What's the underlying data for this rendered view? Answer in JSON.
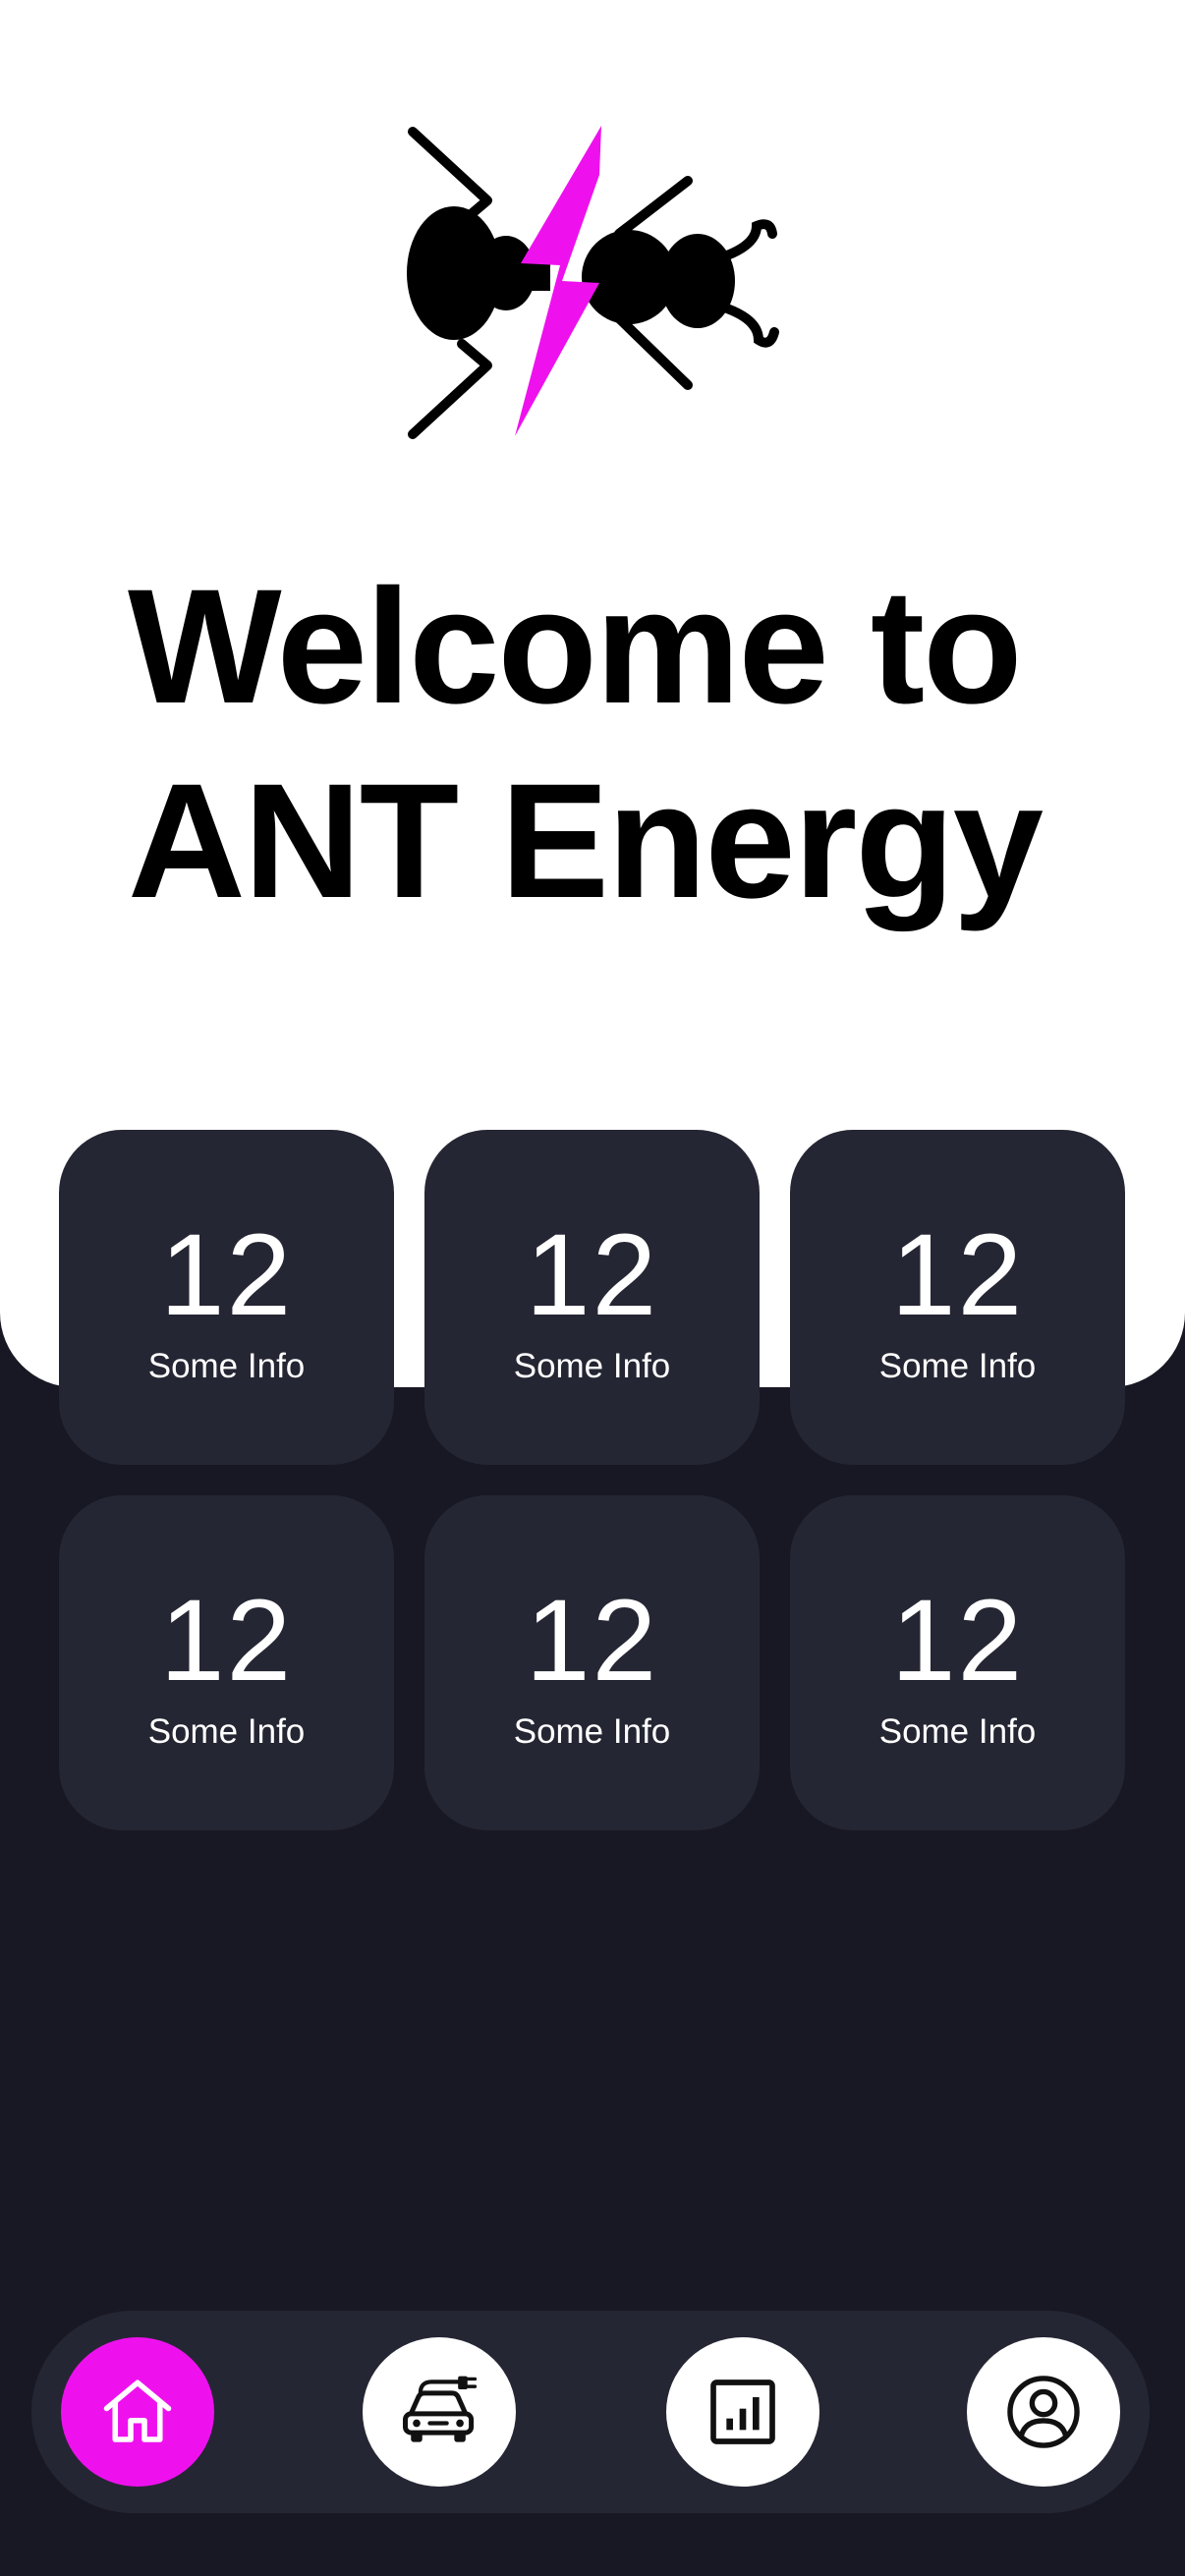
{
  "app": {
    "logo_icon": "ant-lightning-logo",
    "brand_accent": "#EE11EE"
  },
  "welcome": {
    "line1": "Welcome to",
    "line2": "ANT Energy"
  },
  "stats": [
    {
      "value": "12",
      "label": "Some Info"
    },
    {
      "value": "12",
      "label": "Some Info"
    },
    {
      "value": "12",
      "label": "Some Info"
    },
    {
      "value": "12",
      "label": "Some Info"
    },
    {
      "value": "12",
      "label": "Some Info"
    },
    {
      "value": "12",
      "label": "Some Info"
    }
  ],
  "nav": {
    "items": [
      {
        "icon": "home-icon",
        "active": true
      },
      {
        "icon": "ev-car-charging-icon",
        "active": false
      },
      {
        "icon": "bar-chart-icon",
        "active": false
      },
      {
        "icon": "user-profile-icon",
        "active": false
      }
    ]
  },
  "colors": {
    "background_dark": "#181824",
    "card": "#252633",
    "hero": "#FFFFFF",
    "accent": "#EE11EE"
  }
}
